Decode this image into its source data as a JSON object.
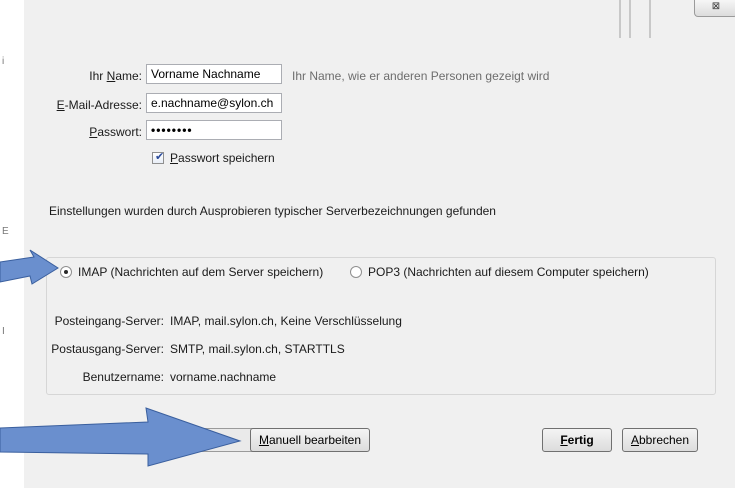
{
  "window": {
    "close_glyph": "⊠",
    "left_strip_marks": [
      "i",
      "E",
      "I"
    ]
  },
  "form": {
    "name_label_prefix": "Ihr ",
    "name_label_ul": "N",
    "name_label_rest": "ame:",
    "name_value": "Vorname Nachname",
    "name_hint": "Ihr Name, wie er anderen Personen gezeigt wird",
    "email_label_ul": "E",
    "email_label_rest": "-Mail-Adresse:",
    "email_value": "e.nachname@sylon.ch",
    "password_label_ul": "P",
    "password_label_rest": "asswort:",
    "password_value": "••••••••",
    "save_password_ul": "P",
    "save_password_rest": "asswort speichern",
    "save_password_checked": true
  },
  "status_message": "Einstellungen wurden durch Ausprobieren typischer Serverbezeichnungen gefunden",
  "protocol": {
    "imap_label": "IMAP (Nachrichten auf dem Server speichern)",
    "pop3_label": "POP3 (Nachrichten auf diesem Computer speichern)",
    "selected": "imap"
  },
  "server_info": {
    "incoming_label": "Posteingang-Server:",
    "incoming_value": "IMAP, mail.sylon.ch, Keine Verschlüsselung",
    "outgoing_label": "Postausgang-Server:",
    "outgoing_value": "SMTP, mail.sylon.ch, STARTTLS",
    "username_label": "Benutzername:",
    "username_value": "vorname.nachname"
  },
  "buttons": {
    "hidden_button_tail": "...",
    "manual_edit_ul": "M",
    "manual_edit_rest": "anuell bearbeiten",
    "done_ul": "F",
    "done_rest": "ertig",
    "cancel_ul": "A",
    "cancel_rest": "bbrechen"
  },
  "colors": {
    "arrow_fill": "#6a8fce",
    "arrow_stroke": "#3a5f9e"
  }
}
